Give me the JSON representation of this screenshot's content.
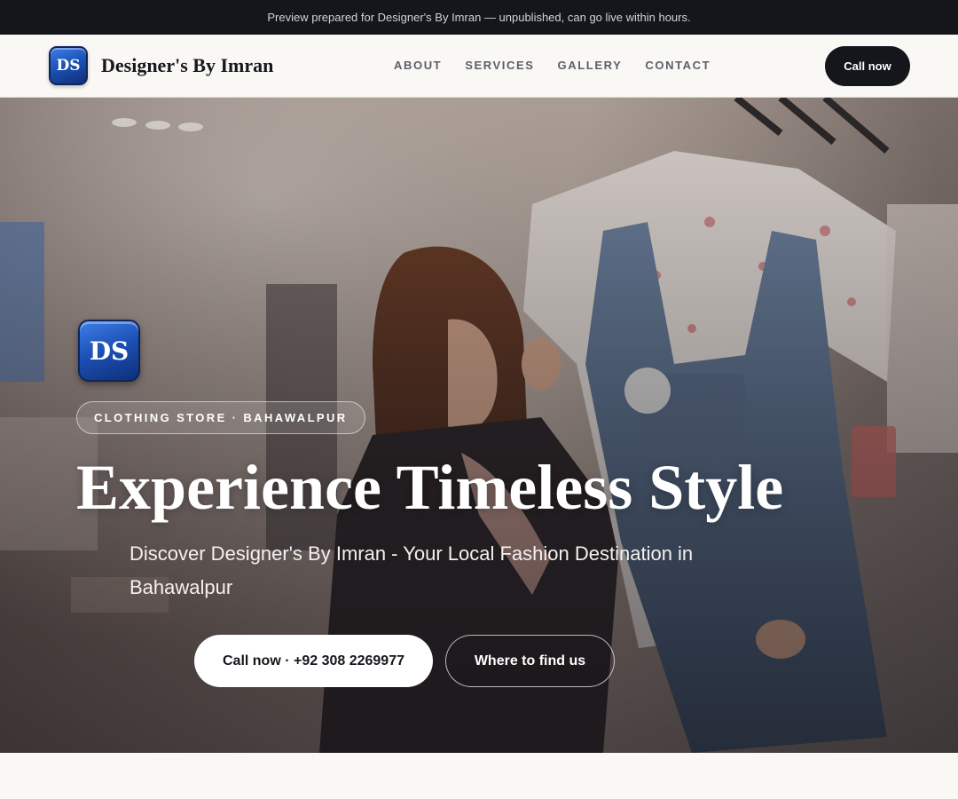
{
  "preview_bar": {
    "text": "Preview prepared for Designer's By Imran — unpublished, can go live within hours."
  },
  "header": {
    "logo_text": "DS",
    "brand_name": "Designer's By Imran",
    "nav": [
      "ABOUT",
      "SERVICES",
      "GALLERY",
      "CONTACT"
    ],
    "cta_label": "Call now"
  },
  "hero": {
    "logo_text": "DS",
    "tagline": "CLOTHING STORE · BAHAWALPUR",
    "title": "Experience Timeless Style",
    "subtitle": "Discover Designer's By Imran - Your Local Fashion Destination in Bahawalpur",
    "primary_cta": "Call now · +92 308 2269977",
    "secondary_cta": "Where to find us"
  },
  "colors": {
    "dark": "#14161c",
    "background": "#faf8f4",
    "logo_blue": "#1b4fb2"
  }
}
